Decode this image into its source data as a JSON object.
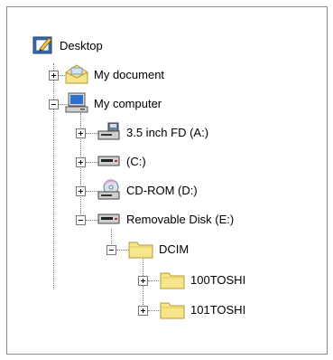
{
  "tree": {
    "desktop": {
      "label": "Desktop",
      "icon": "desktop-icon"
    },
    "my_document": {
      "label": "My document",
      "icon": "folder-envelope-icon",
      "state": "collapsed"
    },
    "my_computer": {
      "label": "My computer",
      "icon": "computer-icon",
      "state": "expanded"
    },
    "floppy": {
      "label": "3.5 inch FD (A:)",
      "icon": "floppy-drive-icon",
      "state": "collapsed"
    },
    "drive_c": {
      "label": "(C:)",
      "icon": "hard-drive-icon",
      "state": "collapsed"
    },
    "cdrom": {
      "label": "CD-ROM (D:)",
      "icon": "cd-drive-icon",
      "state": "collapsed"
    },
    "removable": {
      "label": "Removable Disk (E:)",
      "icon": "removable-disk-icon",
      "state": "expanded"
    },
    "dcim": {
      "label": "DCIM",
      "icon": "folder-icon",
      "state": "expanded"
    },
    "folder_100": {
      "label": "100TOSHI",
      "icon": "folder-icon",
      "state": "collapsed"
    },
    "folder_101": {
      "label": "101TOSHI",
      "icon": "folder-icon",
      "state": "collapsed"
    }
  },
  "colors": {
    "folder": "#f7e58b",
    "folder_border": "#b59a2e",
    "border": "#8a8a8a",
    "connector": "#7a7a7a"
  }
}
